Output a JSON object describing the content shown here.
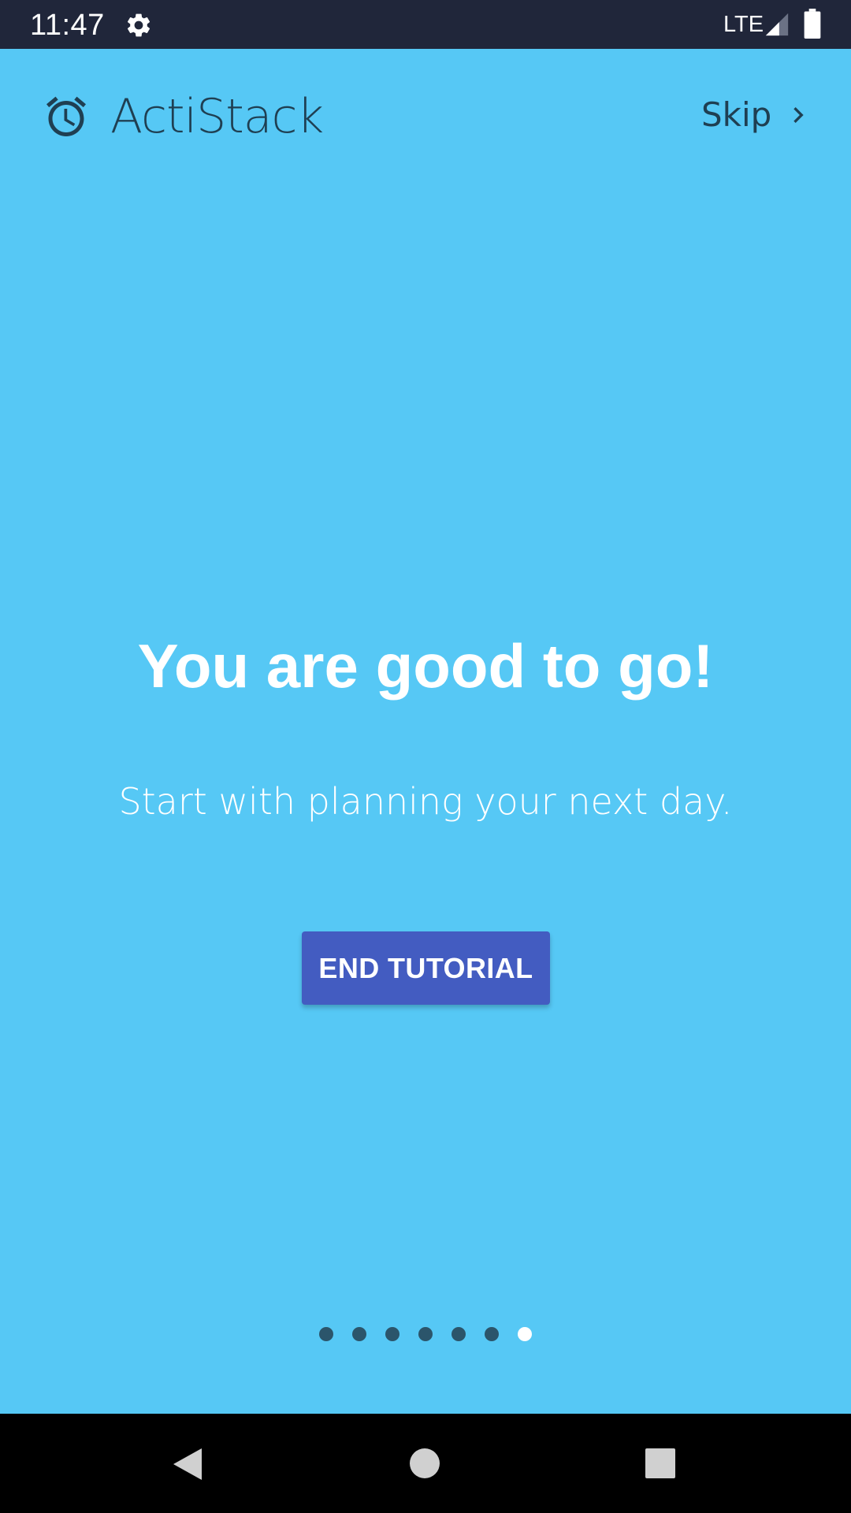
{
  "status_bar": {
    "time": "11:47",
    "network": "LTE",
    "icons": [
      "gear-icon",
      "signal-icon",
      "battery-icon"
    ]
  },
  "header": {
    "app_name": "ActiStack",
    "logo_icon": "alarm-clock-icon",
    "skip_label": "Skip",
    "skip_icon": "chevron-right-icon"
  },
  "main": {
    "headline": "You are good to go!",
    "subtitle": "Start with planning your next day.",
    "end_tutorial_label": "END TUTORIAL"
  },
  "pager": {
    "total_pages": 7,
    "current_page": 7
  },
  "nav_bar": {
    "icons": [
      "back-icon",
      "home-icon",
      "recents-icon"
    ]
  },
  "colors": {
    "background": "#56c8f5",
    "status_bar": "#20263a",
    "header_text": "#1f3f52",
    "button": "#435cc1",
    "dot_inactive": "#2b556b",
    "dot_active": "#ffffff"
  }
}
